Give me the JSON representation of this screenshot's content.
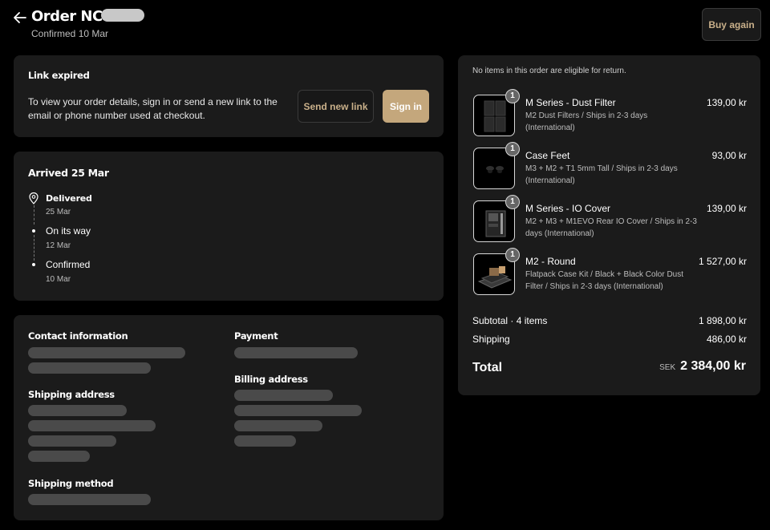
{
  "header": {
    "title": "Order NC",
    "subtitle": "Confirmed 10 Mar",
    "buy_again": "Buy again",
    "icons": {
      "back": "arrow-left-icon"
    }
  },
  "link_card": {
    "heading": "Link expired",
    "message": "To view your order details, sign in or send a new link to the email or phone number used at checkout.",
    "send_label": "Send new link",
    "sign_label": "Sign in"
  },
  "timeline": {
    "heading": "Arrived 25 Mar",
    "steps": [
      {
        "label": "Delivered",
        "date": "25 Mar",
        "icon": "map-pin-icon"
      },
      {
        "label": "On its way",
        "date": "12 Mar"
      },
      {
        "label": "Confirmed",
        "date": "10 Mar"
      }
    ]
  },
  "details": {
    "contact_heading": "Contact information",
    "payment_heading": "Payment",
    "billing_heading": "Billing address",
    "shipping_heading": "Shipping address",
    "method_heading": "Shipping method"
  },
  "summary": {
    "note": "No items in this order are eligible for return.",
    "items": [
      {
        "name": "M Series - Dust Filter",
        "desc": "M2 Dust Filters / Ships in 2-3 days (International)",
        "price": "139,00 kr",
        "qty": "1"
      },
      {
        "name": "Case Feet",
        "desc": "M3 + M2 + T1 5mm Tall / Ships in 2-3 days (International)",
        "price": "93,00 kr",
        "qty": "1"
      },
      {
        "name": "M Series - IO Cover",
        "desc": "M2 + M3 + M1EVO Rear IO Cover / Ships in 2-3 days (International)",
        "price": "139,00 kr",
        "qty": "1"
      },
      {
        "name": "M2 - Round",
        "desc": "Flatpack Case Kit / Black + Black Color Dust Filter / Ships in 2-3 days (International)",
        "price": "1 527,00 kr",
        "qty": "1"
      }
    ],
    "subtotal_label": "Subtotal · 4 items",
    "subtotal_value": "1 898,00 kr",
    "shipping_label": "Shipping",
    "shipping_value": "486,00 kr",
    "total_label": "Total",
    "currency": "SEK",
    "total_value": "2 384,00 kr"
  },
  "colors": {
    "background": "#000000",
    "card": "#1b1b1b",
    "accent": "#c4a77c",
    "accent_text": "#c9b08a",
    "placeholder": "#4a4a4a"
  }
}
